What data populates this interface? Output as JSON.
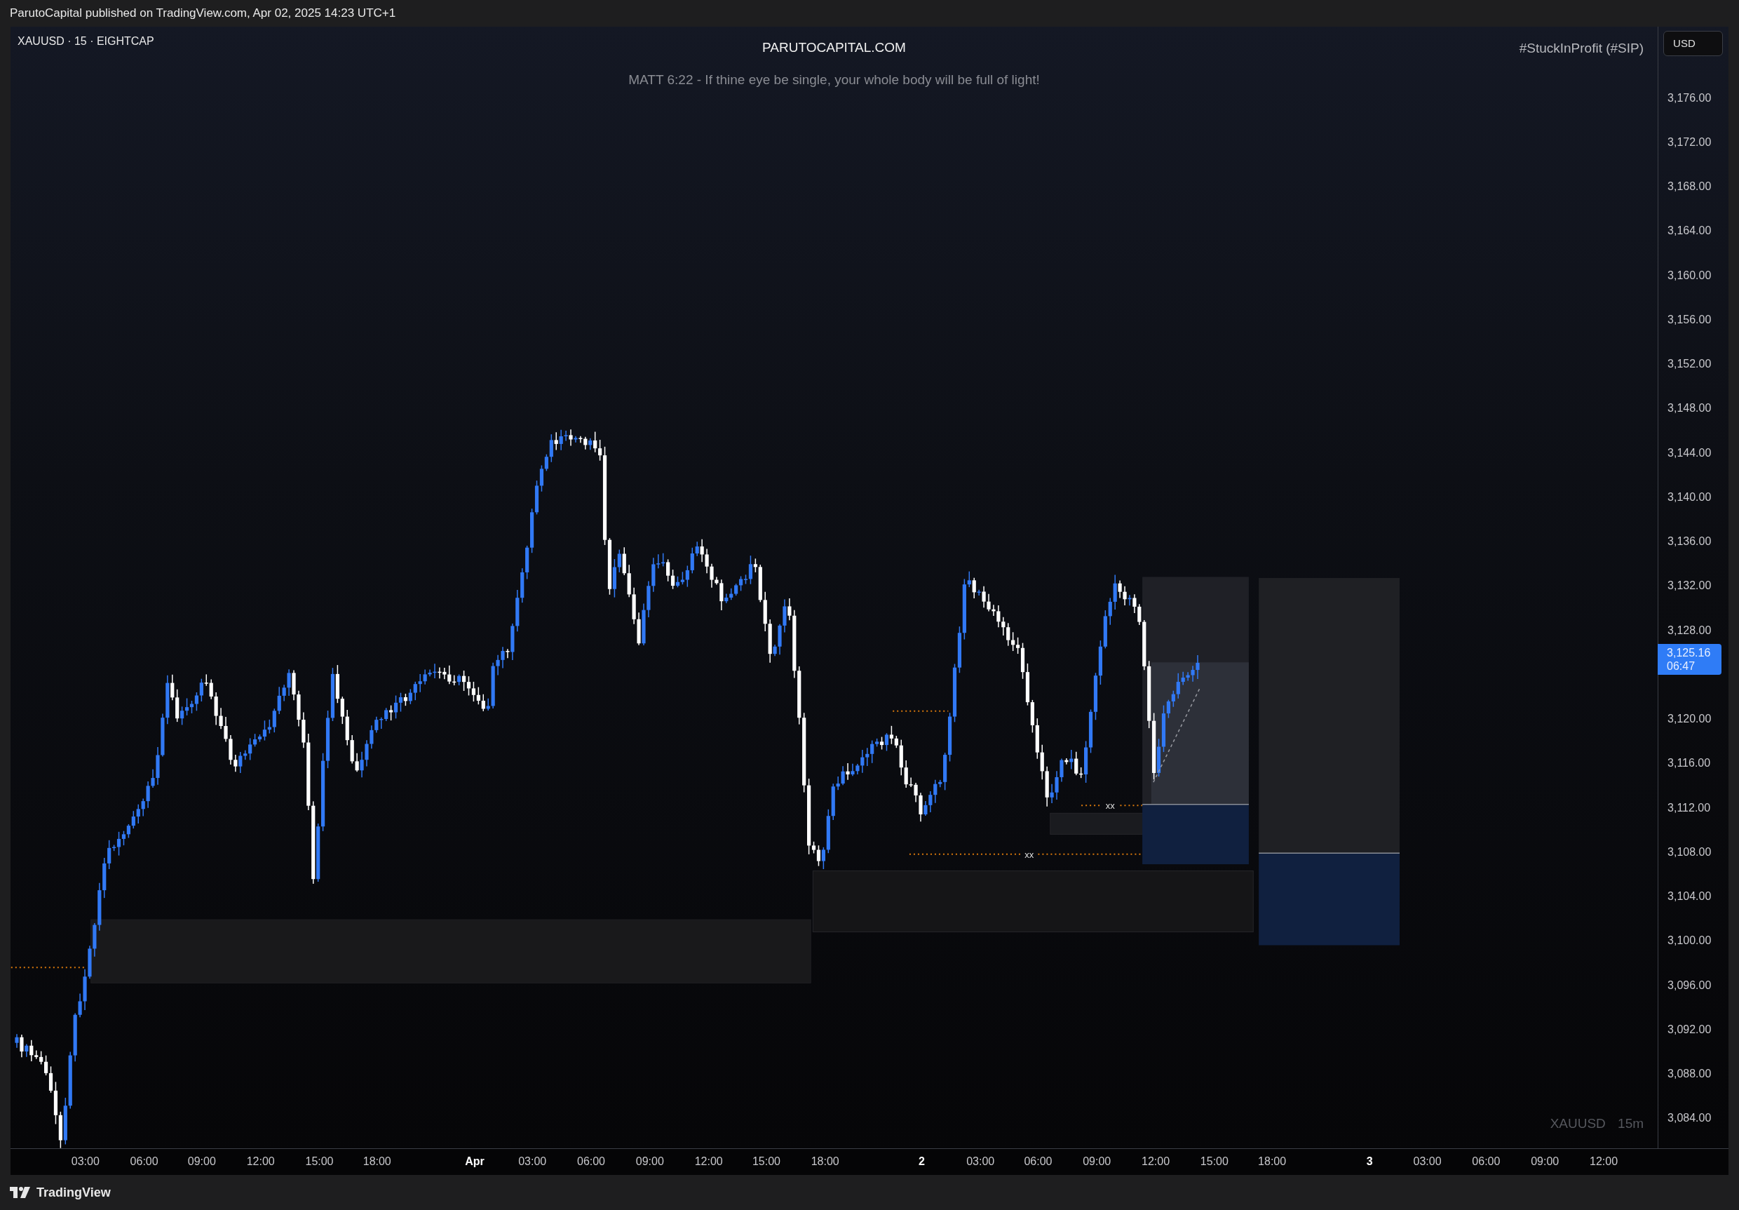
{
  "header": {
    "text": "ParutoCapital published on TradingView.com, Apr 02, 2025 14:23 UTC+1"
  },
  "legend": {
    "symbol": "XAUUSD · 15 · EIGHTCAP"
  },
  "title": "PARUTOCAPITAL.COM",
  "subtitle": "MATT 6:22 - If thine eye be single, your whole body will be full of light!",
  "tag": "#StuckInProfit (#SIP)",
  "watermark": {
    "symbol": "XAUUSD",
    "interval": "15m"
  },
  "markers": [
    "xx",
    "xx"
  ],
  "price_axis": {
    "currency": "USD",
    "labels": [
      {
        "kind": "price",
        "label": "3,176.00"
      },
      {
        "kind": "price",
        "label": "3,172.00"
      },
      {
        "kind": "price",
        "label": "3,168.00"
      },
      {
        "kind": "price",
        "label": "3,164.00"
      },
      {
        "kind": "price",
        "label": "3,160.00"
      },
      {
        "kind": "price",
        "label": "3,156.00"
      },
      {
        "kind": "price",
        "label": "3,152.00"
      },
      {
        "kind": "price",
        "label": "3,148.00"
      },
      {
        "kind": "price",
        "label": "3,144.00"
      },
      {
        "kind": "price",
        "label": "3,140.00"
      },
      {
        "kind": "price",
        "label": "3,136.00"
      },
      {
        "kind": "price",
        "label": "3,132.00"
      },
      {
        "kind": "price",
        "label": "3,128.00"
      },
      {
        "kind": "last",
        "price": "3,125.16",
        "countdown": "06:47"
      },
      {
        "kind": "price",
        "label": "3,120.00"
      },
      {
        "kind": "price",
        "label": "3,116.00"
      },
      {
        "kind": "price",
        "label": "3,112.00"
      },
      {
        "kind": "price",
        "label": "3,108.00"
      },
      {
        "kind": "price",
        "label": "3,104.00"
      },
      {
        "kind": "price",
        "label": "3,100.00"
      },
      {
        "kind": "price",
        "label": "3,096.00"
      },
      {
        "kind": "price",
        "label": "3,092.00"
      },
      {
        "kind": "price",
        "label": "3,088.00"
      },
      {
        "kind": "price",
        "label": "3,084.00"
      }
    ]
  },
  "time_axis": [
    {
      "label": "03:00",
      "kind": "time"
    },
    {
      "label": "06:00",
      "kind": "time"
    },
    {
      "label": "09:00",
      "kind": "time"
    },
    {
      "label": "12:00",
      "kind": "time"
    },
    {
      "label": "15:00",
      "kind": "time"
    },
    {
      "label": "18:00",
      "kind": "time"
    },
    {
      "label": "Apr",
      "kind": "day"
    },
    {
      "label": "03:00",
      "kind": "time"
    },
    {
      "label": "06:00",
      "kind": "time"
    },
    {
      "label": "09:00",
      "kind": "time"
    },
    {
      "label": "12:00",
      "kind": "time"
    },
    {
      "label": "15:00",
      "kind": "time"
    },
    {
      "label": "18:00",
      "kind": "time"
    },
    {
      "label": "2",
      "kind": "day"
    },
    {
      "label": "03:00",
      "kind": "time"
    },
    {
      "label": "06:00",
      "kind": "time"
    },
    {
      "label": "09:00",
      "kind": "time"
    },
    {
      "label": "12:00",
      "kind": "time"
    },
    {
      "label": "15:00",
      "kind": "time"
    },
    {
      "label": "18:00",
      "kind": "time"
    },
    {
      "label": "3",
      "kind": "day"
    },
    {
      "label": "03:00",
      "kind": "time"
    },
    {
      "label": "06:00",
      "kind": "time"
    },
    {
      "label": "09:00",
      "kind": "time"
    },
    {
      "label": "12:00",
      "kind": "time"
    }
  ],
  "footer": {
    "brand": "TradingView"
  }
}
